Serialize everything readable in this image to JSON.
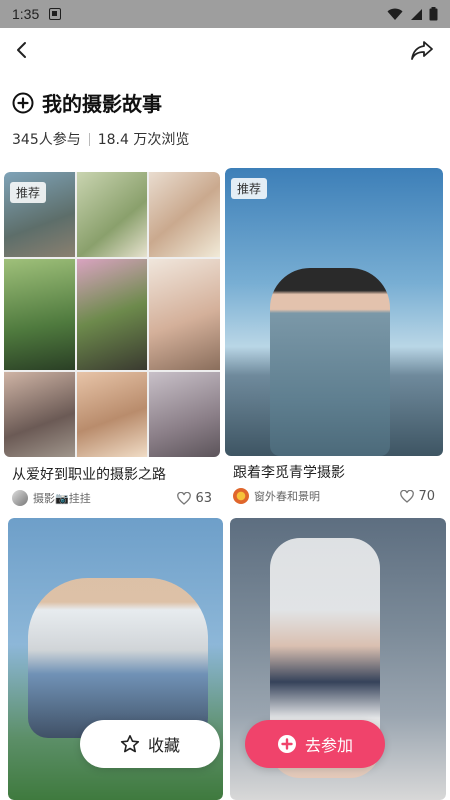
{
  "status_bar": {
    "time": "1:35"
  },
  "page": {
    "title": "我的摄影故事",
    "participants": "345人参与",
    "views": "18.4 万次浏览"
  },
  "cards": [
    {
      "tag": "推荐",
      "title": "从爱好到职业的摄影之路",
      "author": "摄影📷挂挂",
      "likes": "63"
    },
    {
      "tag": "推荐",
      "title": "跟着李觅青学摄影",
      "author": "窗外春和景明",
      "likes": "70"
    },
    {
      "tag": "",
      "title": "",
      "author": "",
      "likes": ""
    },
    {
      "tag": "",
      "title": "",
      "author": "",
      "likes": ""
    }
  ],
  "actions": {
    "collect_label": "收藏",
    "join_label": "去参加"
  },
  "colors": {
    "accent": "#f0436b",
    "status_bar_bg": "#9e9e9e"
  },
  "icons": {
    "back": "chevron-left-icon",
    "share": "share-arrow-icon",
    "topic": "plus-circle-icon",
    "like": "heart-outline-icon",
    "collect": "star-outline-icon",
    "join": "plus-circle-filled-icon"
  }
}
